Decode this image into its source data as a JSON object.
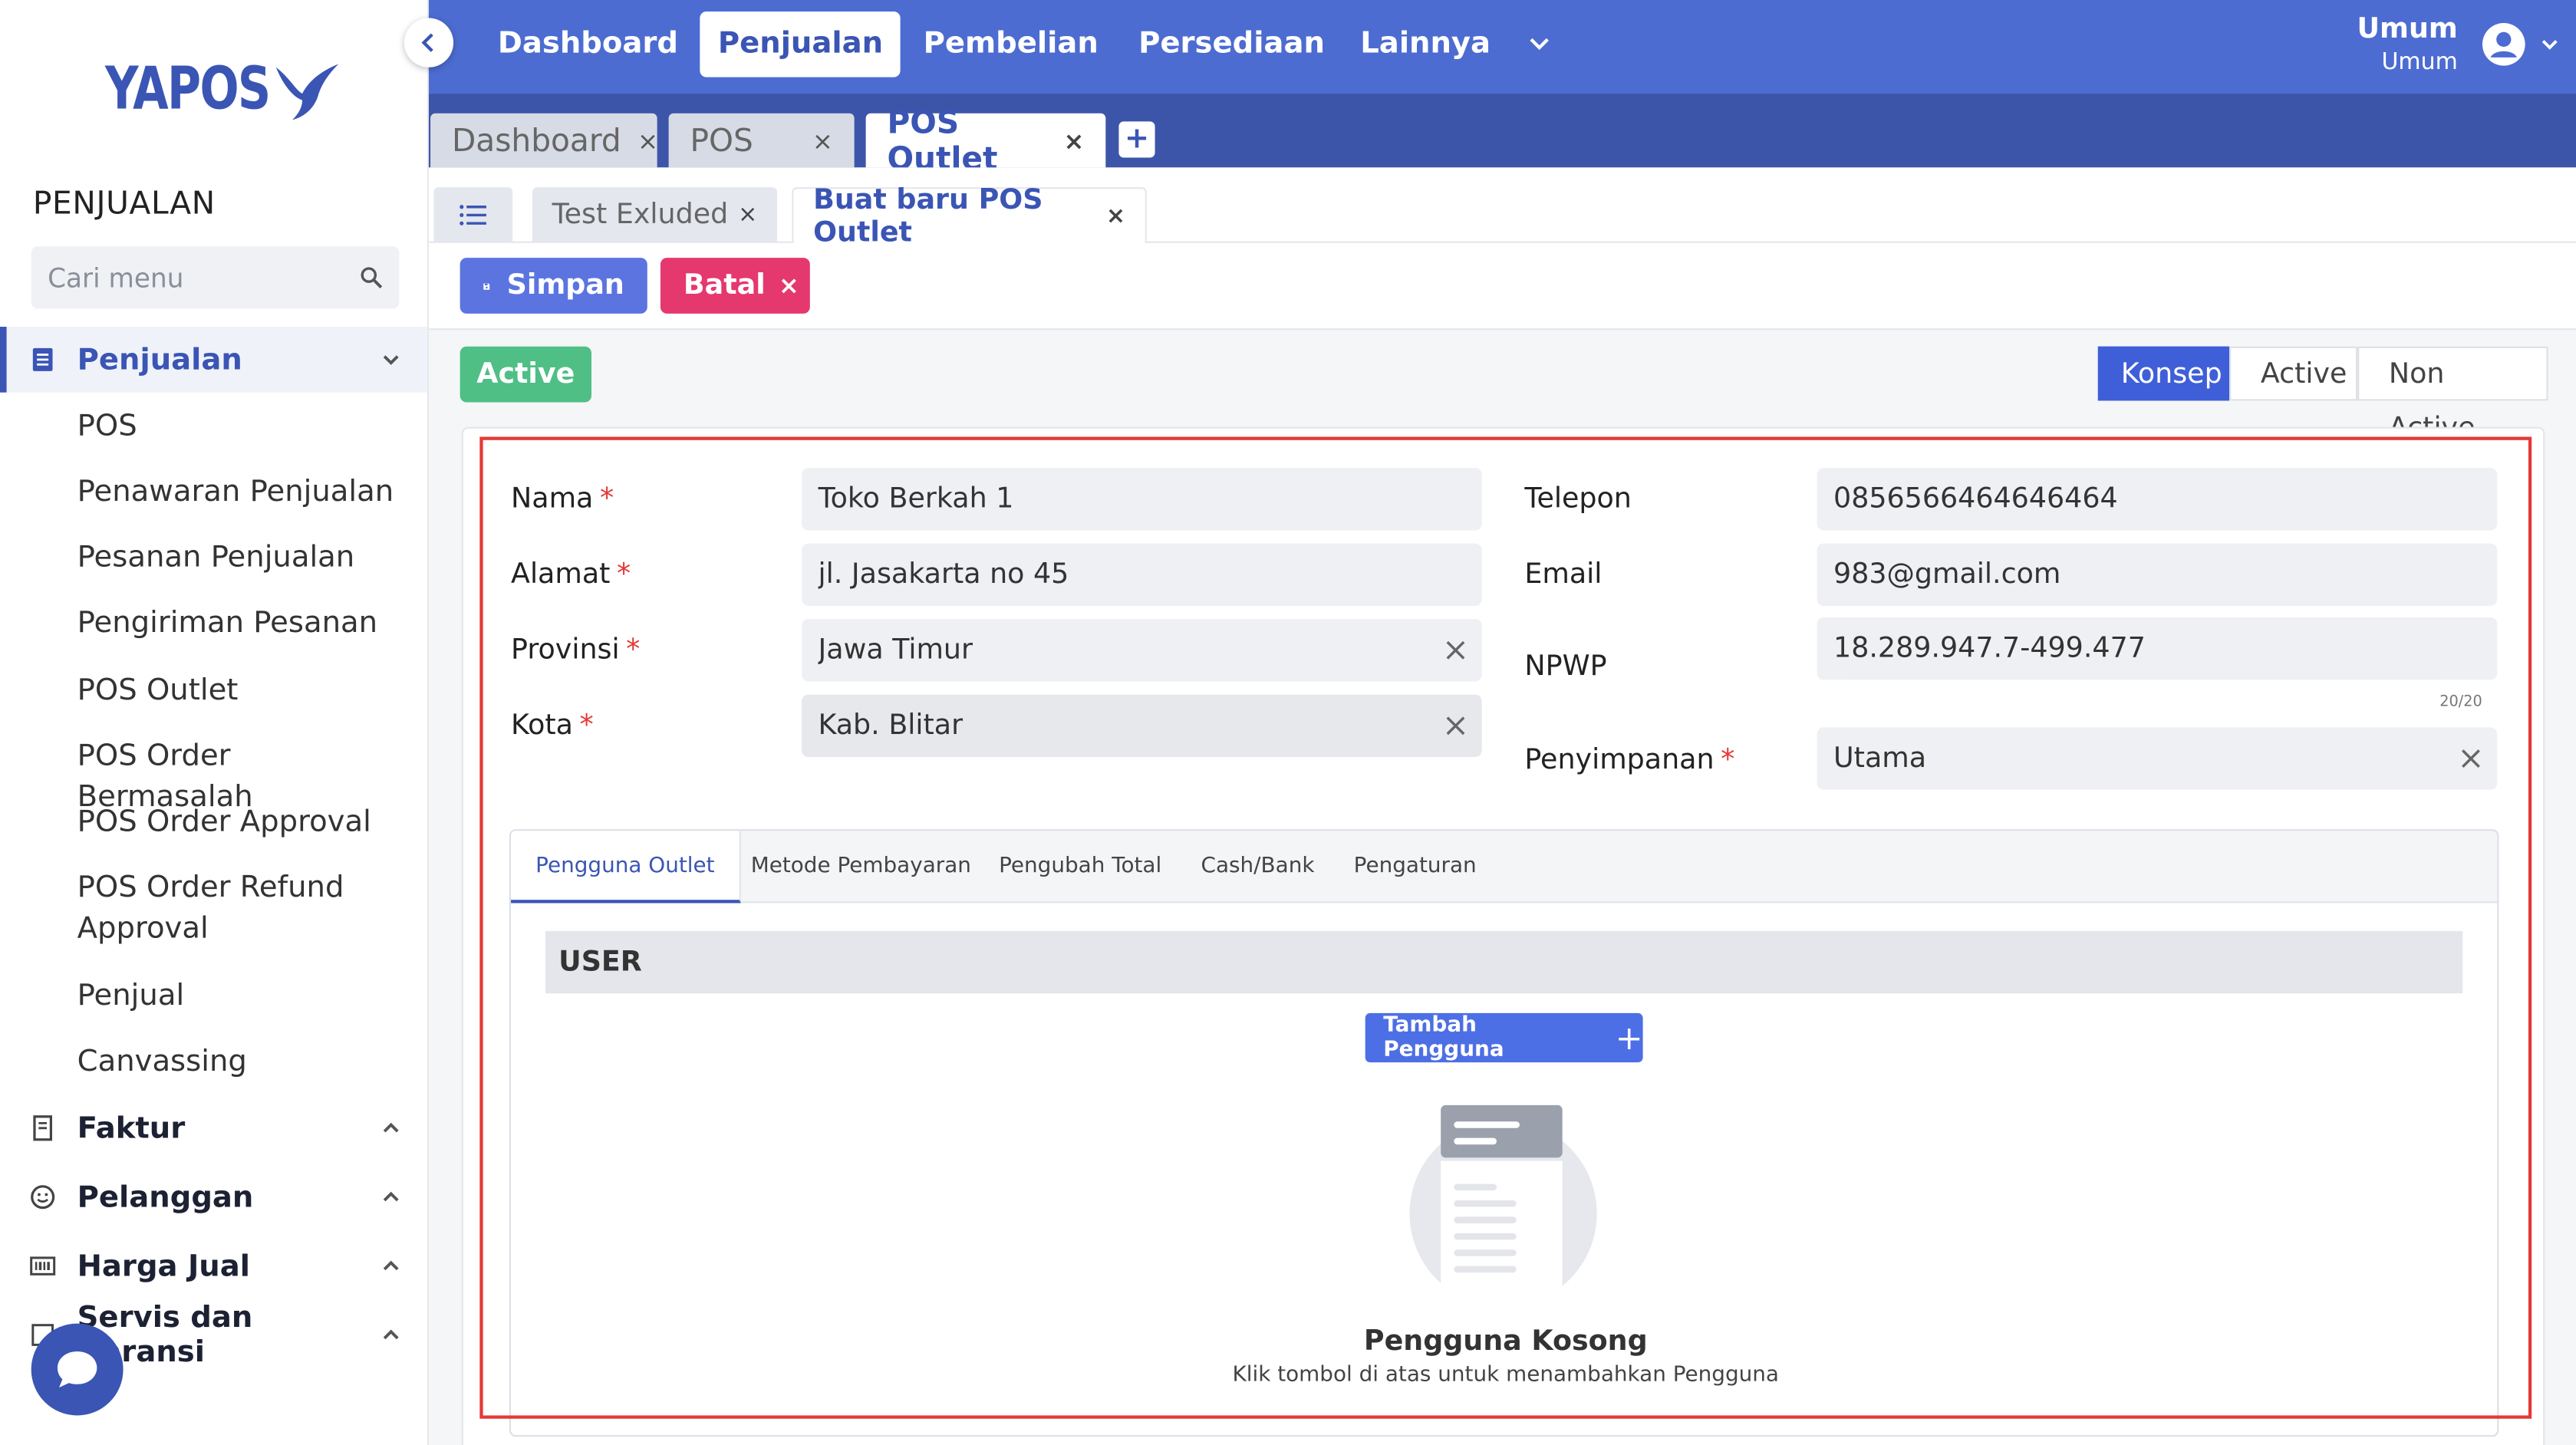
{
  "sidebar": {
    "brand": "YAPOS",
    "section_title": "PENJUALAN",
    "search_placeholder": "Cari menu",
    "groups": [
      {
        "label": "Penjualan",
        "icon": "document-list-icon"
      },
      {
        "label": "Faktur",
        "icon": "invoice-icon"
      },
      {
        "label": "Pelanggan",
        "icon": "smiley-icon"
      },
      {
        "label": "Harga Jual",
        "icon": "barcode-icon"
      },
      {
        "label": "Servis dan Garansi",
        "icon": "service-icon"
      }
    ],
    "submenu": [
      "POS",
      "Penawaran Penjualan",
      "Pesanan Penjualan",
      "Pengiriman Pesanan",
      "POS Outlet",
      "POS Order Bermasalah",
      "POS Order Approval",
      "POS Order Refund Approval",
      "Penjual",
      "Canvassing"
    ]
  },
  "topnav": {
    "items": [
      "Dashboard",
      "Penjualan",
      "Pembelian",
      "Persediaan",
      "Lainnya"
    ],
    "active": "Penjualan",
    "user_name": "Umum",
    "user_sub": "Umum"
  },
  "tabs": [
    {
      "label": "Dashboard",
      "close": "×"
    },
    {
      "label": "POS",
      "close": "×"
    },
    {
      "label": "POS Outlet",
      "close": "×"
    }
  ],
  "tab_add": "+",
  "subtabs": [
    {
      "label": "Test Exluded",
      "close": "×"
    },
    {
      "label": "Buat baru POS Outlet",
      "close": "×"
    }
  ],
  "toolbar": {
    "save_label": "Simpan",
    "cancel_label": "Batal",
    "cancel_x": "×"
  },
  "status": {
    "badge": "Active",
    "steps": [
      "Konsep",
      "Active",
      "Non Active"
    ]
  },
  "form": {
    "nama_label": "Nama",
    "nama_value": "Toko Berkah 1",
    "alamat_label": "Alamat",
    "alamat_value": "jl. Jasakarta no 45",
    "provinsi_label": "Provinsi",
    "provinsi_value": "Jawa Timur",
    "kota_label": "Kota",
    "kota_value": "Kab. Blitar",
    "telepon_label": "Telepon",
    "telepon_value": "0856566464646464",
    "email_label": "Email",
    "email_value": "983@gmail.com",
    "npwp_label": "NPWP",
    "npwp_value": "18.289.947.7-499.477",
    "npwp_counter": "20/20",
    "penyimpanan_label": "Penyimpanan",
    "penyimpanan_value": "Utama",
    "required_mark": "*"
  },
  "inner_tabs": [
    "Pengguna Outlet",
    "Metode Pembayaran",
    "Pengubah Total",
    "Cash/Bank",
    "Pengaturan"
  ],
  "users": {
    "header": "USER",
    "add_button": "Tambah Pengguna",
    "add_plus": "+",
    "empty_title": "Pengguna Kosong",
    "empty_sub": "Klik tombol di atas untuk menambahkan Pengguna"
  },
  "colors": {
    "brand": "#3a55b4",
    "topnav": "#4d6cd1",
    "tabbar": "#3d55a8",
    "save": "#5b74e0",
    "cancel": "#e5386e",
    "active_badge": "#4fbf86",
    "step_active": "#3f5fd9",
    "highlight": "#e53935"
  }
}
